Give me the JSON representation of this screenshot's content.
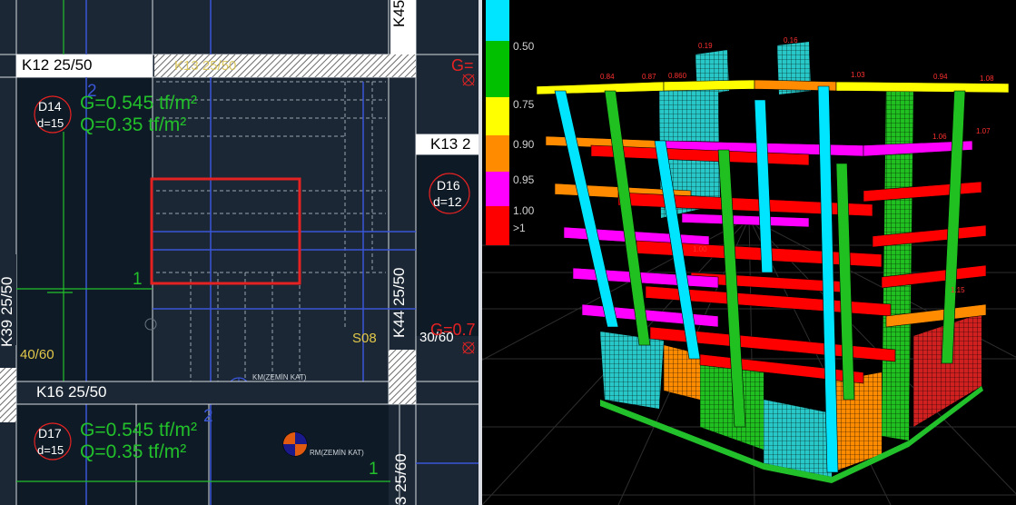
{
  "cad": {
    "beams": {
      "k12": "K12 25/50",
      "k13": "K13 2",
      "k16": "K16 25/50",
      "k45": "K45",
      "k44": "K44 25/50",
      "k39": "K39 25/50",
      "k_bottom_right": "3 25/60",
      "hatched_beam": "K13 25/50"
    },
    "slabs": {
      "d14": {
        "id": "D14",
        "thickness": "d=15"
      },
      "d16": {
        "id": "D16",
        "thickness": "d=12"
      },
      "d17": {
        "id": "D17",
        "thickness": "d=15"
      },
      "s08": "S08"
    },
    "loads": {
      "d14_g": "G=0.545 tf/m²",
      "d14_q": "Q=0.35 tf/m²",
      "d17_g": "G=0.545 tf/m²",
      "d17_q": "Q=0.35 tf/m²",
      "red_g_top": "G=",
      "red_g_mid": "G=0.7"
    },
    "columns": {
      "left_size": "40/60",
      "right_size": "30/60"
    },
    "markers": {
      "axis_2_top": "2",
      "axis_2_bottom": "2",
      "axis_1_left": "1",
      "axis_1_bottom": "1",
      "km_label": "KM(ZEMİN KAT)",
      "rm_label": "RM(ZEMİN KAT)"
    }
  },
  "model3d": {
    "legend": [
      {
        "label": "0.50",
        "color": "#00e5ff"
      },
      {
        "label": "0.75",
        "color": "#00c000"
      },
      {
        "label": "0.90",
        "color": "#ffff00"
      },
      {
        "label": "0.95",
        "color": "#ff8c00"
      },
      {
        "label": "1.00",
        "color": "#ff00ff"
      },
      {
        "label": ">1",
        "color": "#ff0000"
      }
    ],
    "ratio_labels": {
      "top_left_1": "0.19",
      "top_left_2": "0.16",
      "roof_1": "0.84",
      "roof_2": "0.87",
      "roof_3": "0.860",
      "roof_4": "1.03",
      "roof_5": "0.94",
      "roof_6": "1.08",
      "mid_1": "1.00",
      "mid_2": "1.15",
      "mid_3": "1.07",
      "mid_4": "1.06"
    }
  }
}
